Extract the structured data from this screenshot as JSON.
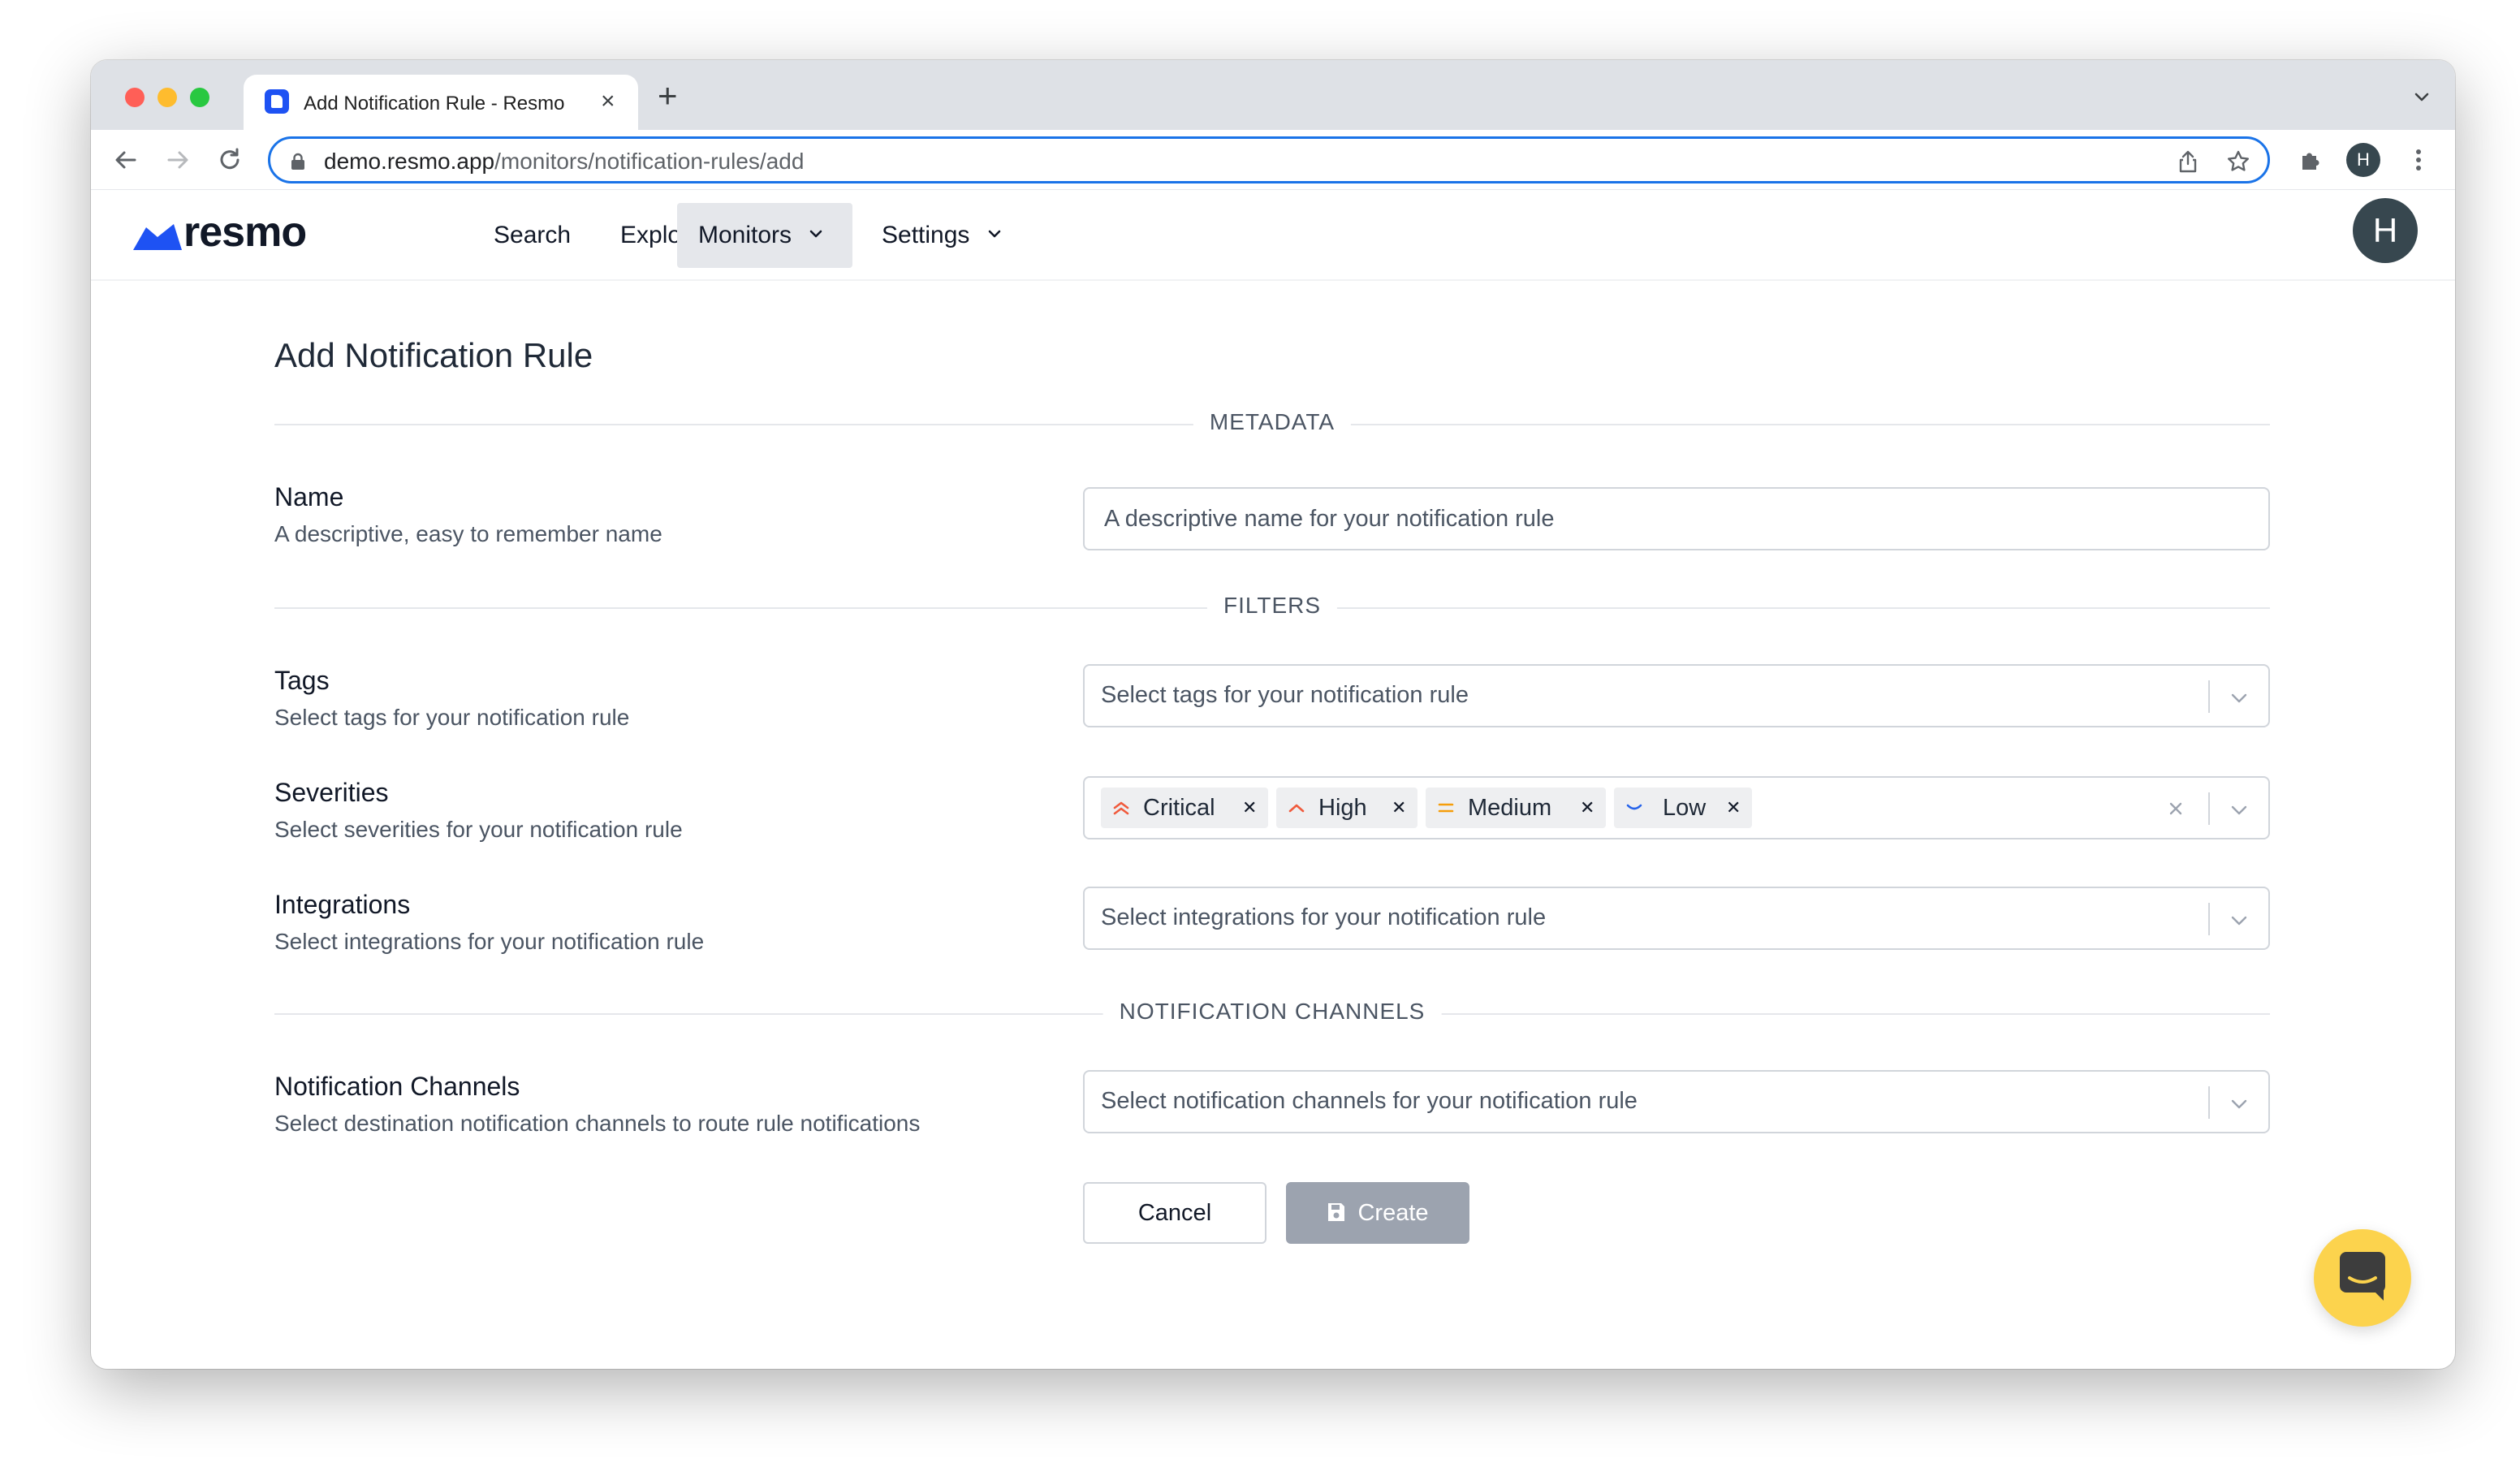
{
  "browser": {
    "tab_title": "Add Notification Rule - Resmo",
    "tab_close": "×",
    "new_tab": "+",
    "url_host": "demo.resmo.app",
    "url_path": "/monitors/notification-rules/add",
    "profile_initial": "H"
  },
  "app": {
    "logo_text": "resmo",
    "brand_color": "#1e52f3",
    "nav": [
      {
        "label": "Search"
      },
      {
        "label": "Explore"
      },
      {
        "label": "Monitors"
      },
      {
        "label": "Settings"
      }
    ],
    "active_nav": "Monitors",
    "avatar_initial": "H"
  },
  "form": {
    "title": "Add Notification Rule",
    "sections": {
      "metadata": "METADATA",
      "filters": "FILTERS",
      "channels": "NOTIFICATION CHANNELS"
    },
    "name": {
      "label": "Name",
      "help": "A descriptive, easy to remember name",
      "value": "",
      "placeholder": "A descriptive name for your notification rule"
    },
    "tags": {
      "label": "Tags",
      "help": "Select tags for your notification rule",
      "placeholder": "Select tags for your notification rule"
    },
    "severities": {
      "label": "Severities",
      "help": "Select severities for your notification rule",
      "selected": [
        {
          "label": "Critical",
          "icon": "double-chevron-up-icon",
          "color": "#f05a3c"
        },
        {
          "label": "High",
          "icon": "chevron-up-icon",
          "color": "#f05a3c"
        },
        {
          "label": "Medium",
          "icon": "equals-icon",
          "color": "#f59e0b"
        },
        {
          "label": "Low",
          "icon": "chevron-down-icon",
          "color": "#2563eb"
        }
      ]
    },
    "integrations": {
      "label": "Integrations",
      "help": "Select integrations for your notification rule",
      "placeholder": "Select integrations for your notification rule"
    },
    "notification_channels": {
      "label": "Notification Channels",
      "help": "Select destination notification channels to route rule notifications",
      "placeholder": "Select notification channels for your notification rule"
    },
    "cancel_label": "Cancel",
    "create_label": "Create"
  },
  "chat_widget": {
    "icon": "chat-icon",
    "color": "#fcd34d"
  }
}
